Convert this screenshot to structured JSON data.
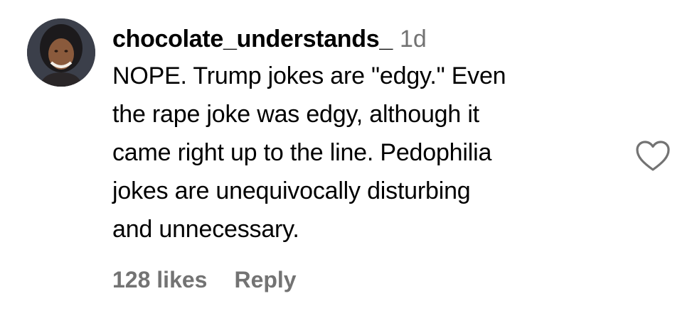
{
  "comment": {
    "username": "chocolate_understands_",
    "timestamp": "1d",
    "text_lines": [
      "NOPE. Trump jokes are \"edgy.\" Even",
      "the rape joke was edgy, although it",
      "came right up to the line. Pedophilia",
      "jokes are unequivocally disturbing",
      "and unnecessary."
    ],
    "likes_label": "128 likes",
    "reply_label": "Reply",
    "like_icon": "heart-outline-icon",
    "colors": {
      "text": "#000000",
      "secondary": "#737373",
      "background": "#ffffff"
    }
  }
}
